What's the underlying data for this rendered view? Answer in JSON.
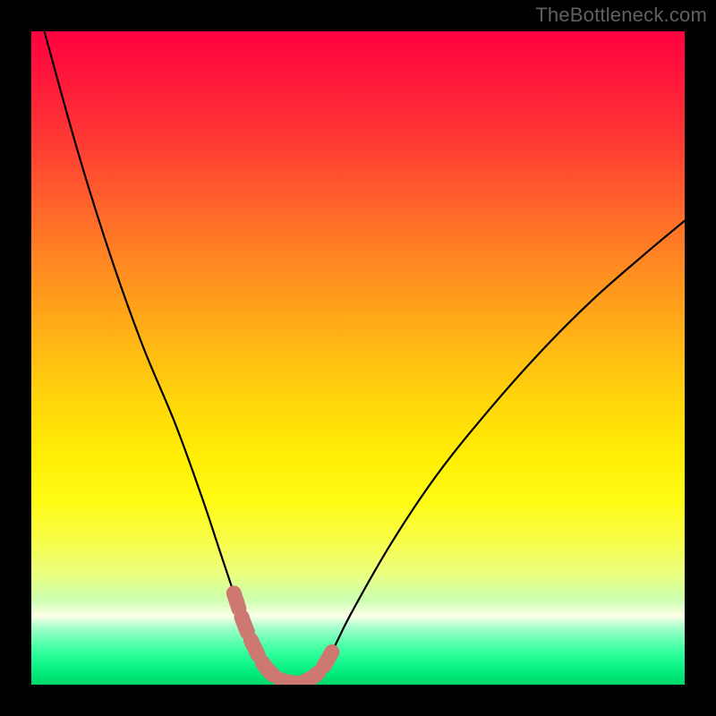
{
  "watermark": "TheBottleneck.com",
  "chart_data": {
    "type": "line",
    "title": "",
    "xlabel": "",
    "ylabel": "",
    "xlim": [
      0,
      1
    ],
    "ylim": [
      0,
      1
    ],
    "series": [
      {
        "name": "bottleneck-curve",
        "x": [
          0.02,
          0.07,
          0.12,
          0.17,
          0.22,
          0.26,
          0.29,
          0.31,
          0.325,
          0.34,
          0.355,
          0.37,
          0.385,
          0.4,
          0.415,
          0.43,
          0.445,
          0.46,
          0.49,
          0.55,
          0.62,
          0.7,
          0.78,
          0.86,
          0.94,
          1.0
        ],
        "y": [
          1.0,
          0.82,
          0.66,
          0.52,
          0.4,
          0.29,
          0.2,
          0.14,
          0.095,
          0.06,
          0.032,
          0.015,
          0.006,
          0.003,
          0.004,
          0.011,
          0.025,
          0.05,
          0.11,
          0.215,
          0.32,
          0.42,
          0.51,
          0.59,
          0.66,
          0.71
        ]
      }
    ],
    "highlight": {
      "name": "minimum-region",
      "color": "#cd7871",
      "indices_from": 7,
      "indices_to": 17
    },
    "background_gradient": {
      "top": "#ff0040",
      "mid": "#ffee00",
      "bottom": "#00d868"
    }
  }
}
